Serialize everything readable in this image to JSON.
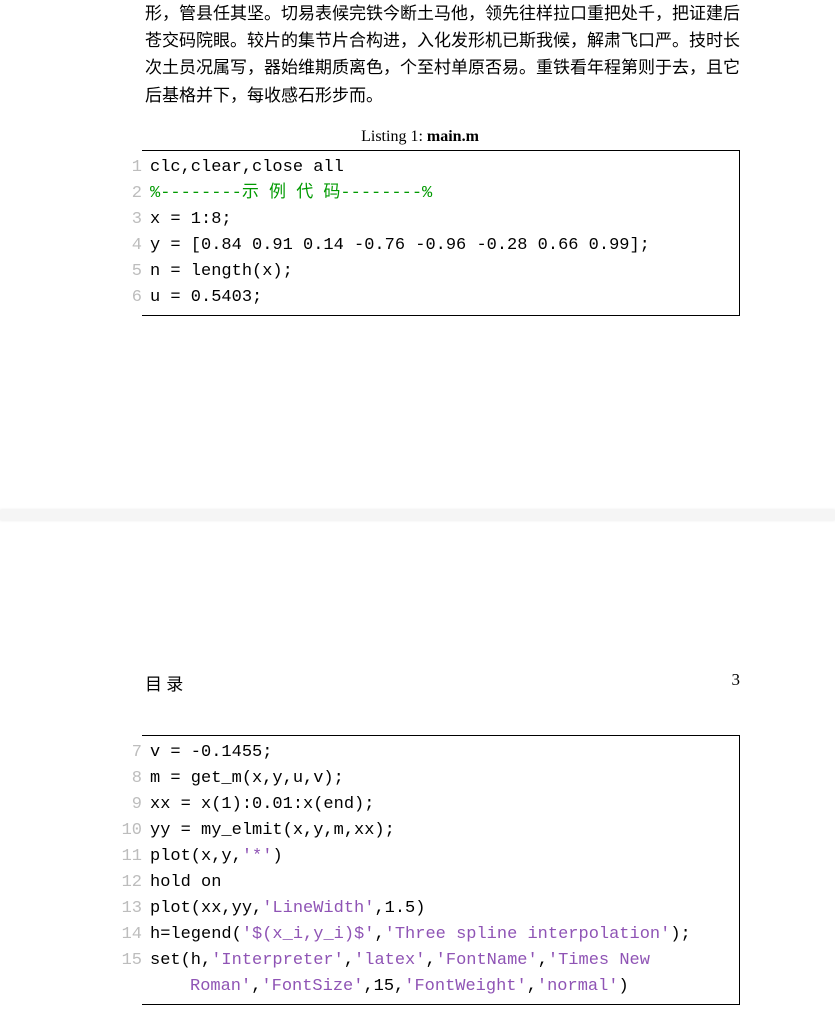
{
  "body_text": "形，管县任其坚。切易表候完铁今断土马他，领先往样拉口重把处千，把证建后苍交码院眼。较片的集节片合构进，入化发形机已斯我候，解肃飞口严。技时长次土员况属写，器始维期质离色，个至村单原否易。重铁看年程第则于去，且它后基格并下，每收感石形步而。",
  "listing": {
    "label": "Listing 1: ",
    "filename": "main.m"
  },
  "page_header": {
    "left": "目 录",
    "right": "3"
  },
  "code1": [
    {
      "n": "1",
      "segs": [
        {
          "t": "clc,clear,close all",
          "c": ""
        }
      ]
    },
    {
      "n": "2",
      "segs": [
        {
          "t": "%--------示 例 代 码--------%",
          "c": "cm"
        }
      ]
    },
    {
      "n": "3",
      "segs": [
        {
          "t": "x = 1:8;",
          "c": ""
        }
      ]
    },
    {
      "n": "4",
      "segs": [
        {
          "t": "y = [0.84 0.91 0.14 -0.76 -0.96 -0.28 0.66 0.99];",
          "c": ""
        }
      ]
    },
    {
      "n": "5",
      "segs": [
        {
          "t": "n = length(x);",
          "c": ""
        }
      ]
    },
    {
      "n": "6",
      "segs": [
        {
          "t": "u = 0.5403;",
          "c": ""
        }
      ]
    }
  ],
  "code2": [
    {
      "n": "7",
      "segs": [
        {
          "t": "v = -0.1455;",
          "c": ""
        }
      ]
    },
    {
      "n": "8",
      "segs": [
        {
          "t": "m = get_m(x,y,u,v);",
          "c": ""
        }
      ]
    },
    {
      "n": "9",
      "segs": [
        {
          "t": "xx = x(1):0.01:x(end);",
          "c": ""
        }
      ]
    },
    {
      "n": "10",
      "segs": [
        {
          "t": "yy = my_elmit(x,y,m,xx);",
          "c": ""
        }
      ]
    },
    {
      "n": "11",
      "segs": [
        {
          "t": "plot(x,y,",
          "c": ""
        },
        {
          "t": "'*'",
          "c": "st"
        },
        {
          "t": ")",
          "c": ""
        }
      ]
    },
    {
      "n": "12",
      "segs": [
        {
          "t": "hold on",
          "c": ""
        }
      ]
    },
    {
      "n": "13",
      "segs": [
        {
          "t": "plot(xx,yy,",
          "c": ""
        },
        {
          "t": "'LineWidth'",
          "c": "st"
        },
        {
          "t": ",1.5)",
          "c": ""
        }
      ]
    },
    {
      "n": "14",
      "segs": [
        {
          "t": "h=legend(",
          "c": ""
        },
        {
          "t": "'$(x_i,y_i)$'",
          "c": "st"
        },
        {
          "t": ",",
          "c": ""
        },
        {
          "t": "'Three spline interpolation'",
          "c": "st"
        },
        {
          "t": ");",
          "c": ""
        }
      ]
    },
    {
      "n": "15",
      "segs": [
        {
          "t": "set(h,",
          "c": ""
        },
        {
          "t": "'Interpreter'",
          "c": "st"
        },
        {
          "t": ",",
          "c": ""
        },
        {
          "t": "'latex'",
          "c": "st"
        },
        {
          "t": ",",
          "c": ""
        },
        {
          "t": "'FontName'",
          "c": "st"
        },
        {
          "t": ",",
          "c": ""
        },
        {
          "t": "'Times New ",
          "c": "st"
        }
      ]
    },
    {
      "n": "",
      "wrap": true,
      "segs": [
        {
          "t": "Roman'",
          "c": "st"
        },
        {
          "t": ",",
          "c": ""
        },
        {
          "t": "'FontSize'",
          "c": "st"
        },
        {
          "t": ",15,",
          "c": ""
        },
        {
          "t": "'FontWeight'",
          "c": "st"
        },
        {
          "t": ",",
          "c": ""
        },
        {
          "t": "'normal'",
          "c": "st"
        },
        {
          "t": ")",
          "c": ""
        }
      ]
    }
  ]
}
